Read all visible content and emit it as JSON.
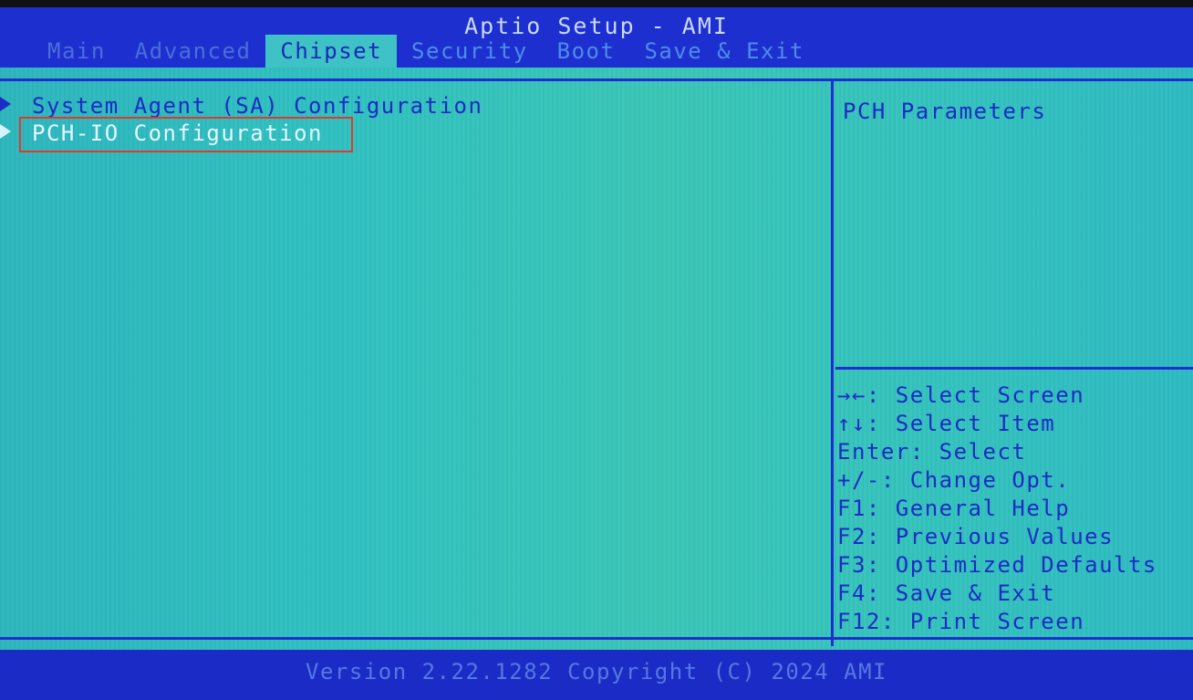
{
  "header": {
    "title": "Aptio Setup - AMI",
    "tabs": [
      {
        "label": "Main"
      },
      {
        "label": "Advanced"
      },
      {
        "label": "Chipset"
      },
      {
        "label": "Security"
      },
      {
        "label": "Boot"
      },
      {
        "label": "Save & Exit"
      }
    ],
    "active_tab": "Chipset"
  },
  "menu": {
    "items": [
      {
        "label": "System Agent (SA) Configuration"
      },
      {
        "label": "PCH-IO Configuration"
      }
    ],
    "selected": "PCH-IO Configuration"
  },
  "help": {
    "text": "PCH Parameters"
  },
  "keys": [
    "→←: Select Screen",
    "↑↓: Select Item",
    "Enter: Select",
    "+/-: Change Opt.",
    "F1: General Help",
    "F2: Previous Values",
    "F3: Optimized Defaults",
    "F4: Save & Exit",
    "F12: Print Screen"
  ],
  "footer": {
    "text": "Version 2.22.1282 Copyright (C) 2024 AMI"
  },
  "colors": {
    "header_bg": "#1e2fd0",
    "main_bg": "#33c3c2",
    "text": "#1c2cc4",
    "highlight_border": "#e23a2a"
  }
}
